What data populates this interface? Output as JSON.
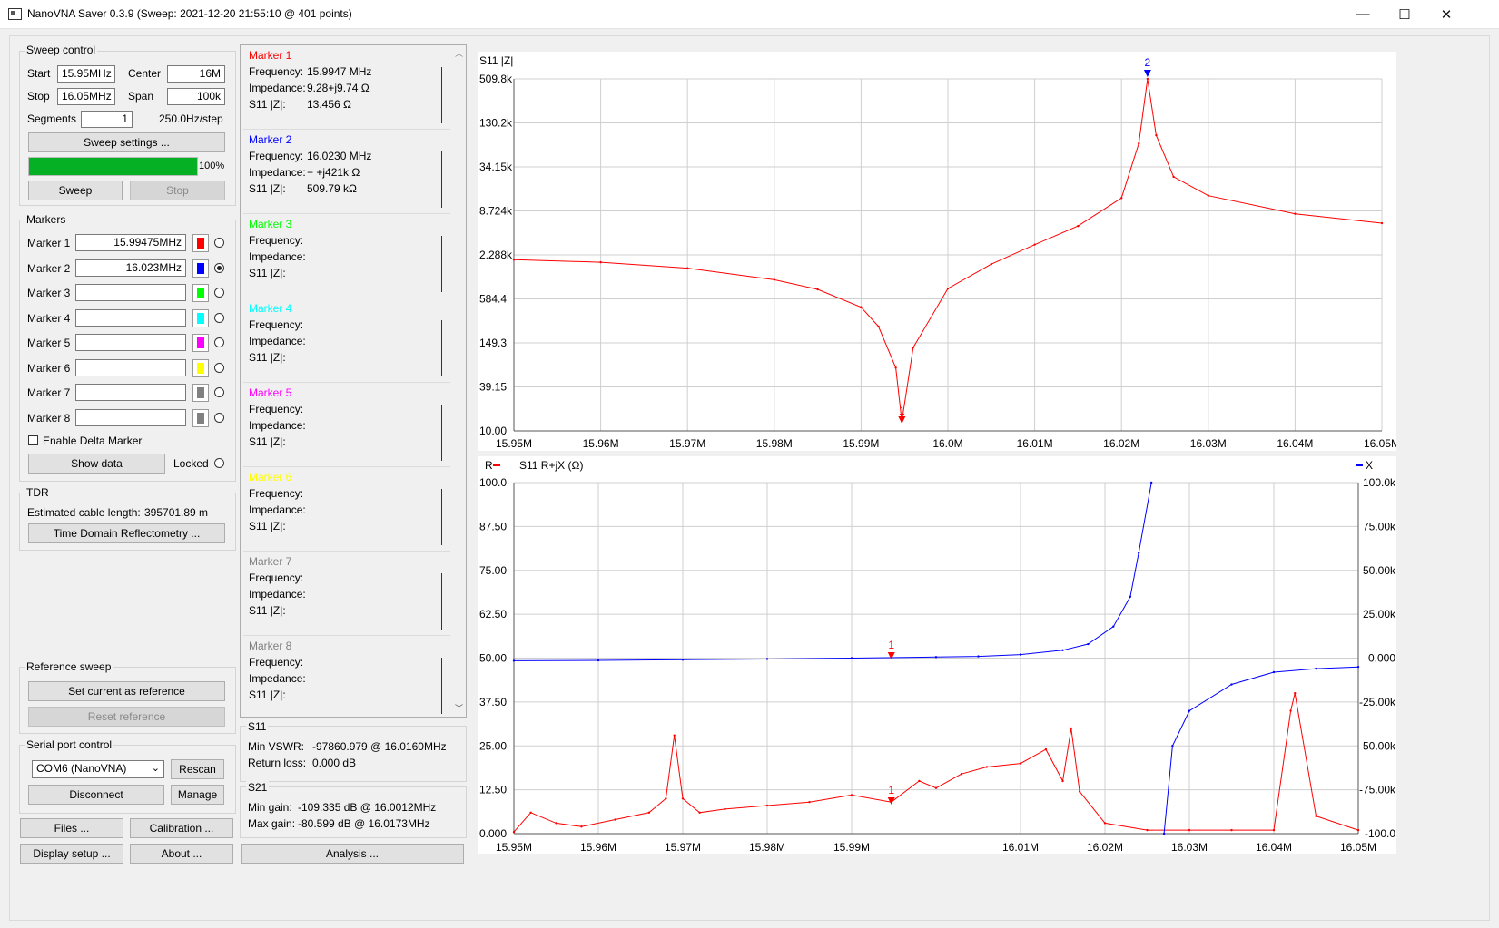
{
  "window": {
    "title": "NanoVNA Saver 0.3.9 (Sweep: 2021-12-20 21:55:10 @ 401 points)",
    "minimize_glyph": "—",
    "maximize_glyph": "☐",
    "close_glyph": "✕"
  },
  "sweep": {
    "group_title": "Sweep control",
    "start_label": "Start",
    "start_value": "15.95MHz",
    "center_label": "Center",
    "center_value": "16M",
    "stop_label": "Stop",
    "stop_value": "16.05MHz",
    "span_label": "Span",
    "span_value": "100k",
    "segments_label": "Segments",
    "segments_value": "1",
    "step_text": "250.0Hz/step",
    "settings_button": "Sweep settings ...",
    "progress_fraction": 1.0,
    "progress_text": "100%",
    "sweep_button": "Sweep",
    "stop_button": "Stop"
  },
  "markers": {
    "group_title": "Markers",
    "items": [
      {
        "label": "Marker 1",
        "value": "15.99475MHz",
        "color": "#ff0000",
        "selected": false
      },
      {
        "label": "Marker 2",
        "value": "16.023MHz",
        "color": "#0000ff",
        "selected": true
      },
      {
        "label": "Marker 3",
        "value": "",
        "color": "#00ff00",
        "selected": false
      },
      {
        "label": "Marker 4",
        "value": "",
        "color": "#00ffff",
        "selected": false
      },
      {
        "label": "Marker 5",
        "value": "",
        "color": "#ff00ff",
        "selected": false
      },
      {
        "label": "Marker 6",
        "value": "",
        "color": "#ffff00",
        "selected": false
      },
      {
        "label": "Marker 7",
        "value": "",
        "color": "#808080",
        "selected": false
      },
      {
        "label": "Marker 8",
        "value": "",
        "color": "#808080",
        "selected": false
      }
    ],
    "delta_label": "Enable Delta Marker",
    "show_data_button": "Show data",
    "locked_label": "Locked"
  },
  "tdr": {
    "group_title": "TDR",
    "cable_label": "Estimated cable length:",
    "cable_value": "395701.89 m",
    "tdr_button": "Time Domain Reflectometry ..."
  },
  "reference": {
    "group_title": "Reference sweep",
    "set_button": "Set current as reference",
    "reset_button": "Reset reference"
  },
  "serial": {
    "group_title": "Serial port control",
    "port_value": "COM6 (NanoVNA)",
    "rescan_button": "Rescan",
    "disconnect_button": "Disconnect",
    "manage_button": "Manage"
  },
  "bottom_buttons": {
    "files": "Files ...",
    "calibration": "Calibration ...",
    "display_setup": "Display setup ...",
    "about": "About ...",
    "analysis": "Analysis ..."
  },
  "marker_details": [
    {
      "title": "Marker 1",
      "color": "#ff0000",
      "freq_label": "Frequency:",
      "freq": "15.9947 MHz",
      "imp_label": "Impedance:",
      "imp": "9.28+j9.74 Ω",
      "s11_label": "S11 |Z|:",
      "s11": "13.456 Ω"
    },
    {
      "title": "Marker 2",
      "color": "#0000ff",
      "freq_label": "Frequency:",
      "freq": "16.0230 MHz",
      "imp_label": "Impedance:",
      "imp": "− +j421k Ω",
      "s11_label": "S11 |Z|:",
      "s11": "509.79 kΩ"
    },
    {
      "title": "Marker 3",
      "color": "#00ff00",
      "freq_label": "Frequency:",
      "freq": "",
      "imp_label": "Impedance:",
      "imp": "",
      "s11_label": "S11 |Z|:",
      "s11": ""
    },
    {
      "title": "Marker 4",
      "color": "#00ffff",
      "freq_label": "Frequency:",
      "freq": "",
      "imp_label": "Impedance:",
      "imp": "",
      "s11_label": "S11 |Z|:",
      "s11": ""
    },
    {
      "title": "Marker 5",
      "color": "#ff00ff",
      "freq_label": "Frequency:",
      "freq": "",
      "imp_label": "Impedance:",
      "imp": "",
      "s11_label": "S11 |Z|:",
      "s11": ""
    },
    {
      "title": "Marker 6",
      "color": "#ffff00",
      "freq_label": "Frequency:",
      "freq": "",
      "imp_label": "Impedance:",
      "imp": "",
      "s11_label": "S11 |Z|:",
      "s11": ""
    },
    {
      "title": "Marker 7",
      "color": "#808080",
      "freq_label": "Frequency:",
      "freq": "",
      "imp_label": "Impedance:",
      "imp": "",
      "s11_label": "S11 |Z|:",
      "s11": ""
    },
    {
      "title": "Marker 8",
      "color": "#808080",
      "freq_label": "Frequency:",
      "freq": "",
      "imp_label": "Impedance:",
      "imp": "",
      "s11_label": "S11 |Z|:",
      "s11": ""
    }
  ],
  "s11_summary": {
    "title": "S11",
    "vswr_label": "Min VSWR:",
    "vswr_value": "-97860.979 @ 16.0160MHz",
    "rl_label": "Return loss:",
    "rl_value": "0.000 dB"
  },
  "s21_summary": {
    "title": "S21",
    "min_label": "Min gain:",
    "min_value": "-109.335 dB @ 16.0012MHz",
    "max_label": "Max gain:",
    "max_value": "-80.599 dB @ 16.0173MHz"
  },
  "chart_data": [
    {
      "type": "line",
      "title": "S11 |Z|",
      "y_scale": "log",
      "x_ticks": [
        "15.95M",
        "15.96M",
        "15.97M",
        "15.98M",
        "15.99M",
        "16.0M",
        "16.01M",
        "16.02M",
        "16.03M",
        "16.04M",
        "16.05M"
      ],
      "y_ticks": [
        "509.8k",
        "130.2k",
        "34.15k",
        "8.724k",
        "2.288k",
        "584.4",
        "149.3",
        "39.15",
        "10.00"
      ],
      "xlim": [
        15.95,
        16.05
      ],
      "ylim": [
        10.0,
        509800
      ],
      "grid": true,
      "series": [
        {
          "color": "#ff0000",
          "x": [
            15.95,
            15.96,
            15.97,
            15.98,
            15.985,
            15.99,
            15.992,
            15.994,
            15.9947,
            15.996,
            16.0,
            16.005,
            16.01,
            16.015,
            16.02,
            16.022,
            16.023,
            16.024,
            16.026,
            16.03,
            16.04,
            16.05
          ],
          "y": [
            1950,
            1800,
            1500,
            1050,
            780,
            450,
            250,
            70,
            13.456,
            130,
            800,
            1700,
            3100,
            5500,
            13000,
            70000,
            509790,
            90000,
            25000,
            14000,
            8000,
            6000
          ]
        }
      ],
      "markers": [
        {
          "label": "1",
          "x": 15.9947,
          "color": "#ff0000",
          "position": "bottom"
        },
        {
          "label": "2",
          "x": 16.023,
          "color": "#0000ff",
          "position": "top"
        }
      ]
    },
    {
      "type": "line",
      "title": "S11 R+jX (Ω)",
      "left_legend": "R",
      "right_legend": "X",
      "x_ticks": [
        "15.95M",
        "15.96M",
        "15.97M",
        "15.98M",
        "15.99M",
        "16.01M",
        "16.02M",
        "16.03M",
        "16.04M",
        "16.05M"
      ],
      "x_tick_values": [
        15.95,
        15.96,
        15.97,
        15.98,
        15.99,
        16.01,
        16.02,
        16.03,
        16.04,
        16.05
      ],
      "y_left_ticks": [
        "100.0",
        "87.50",
        "75.00",
        "62.50",
        "50.00",
        "37.50",
        "25.00",
        "12.50",
        "0.000"
      ],
      "y_right_ticks": [
        "100.0k",
        "75.00k",
        "50.00k",
        "25.00k",
        "0.000",
        "-25.00k",
        "-50.00k",
        "-75.00k",
        "-100.0"
      ],
      "xlim": [
        15.95,
        16.05
      ],
      "ylim_left": [
        0,
        100
      ],
      "ylim_right": [
        -100000,
        100000
      ],
      "grid": true,
      "series": [
        {
          "name": "R",
          "axis": "left",
          "color": "#ff0000",
          "x": [
            15.95,
            15.952,
            15.955,
            15.958,
            15.962,
            15.966,
            15.968,
            15.969,
            15.97,
            15.972,
            15.975,
            15.98,
            15.985,
            15.99,
            15.9947,
            15.998,
            16.0,
            16.003,
            16.006,
            16.01,
            16.013,
            16.015,
            16.016,
            16.017,
            16.02,
            16.025,
            16.03,
            16.035,
            16.04,
            16.042,
            16.0425,
            16.045,
            16.05
          ],
          "y": [
            0.5,
            6,
            3,
            2,
            4,
            6,
            10,
            28,
            10,
            6,
            7,
            8,
            9,
            11,
            9,
            15,
            13,
            17,
            19,
            20,
            24,
            15,
            30,
            12,
            3,
            1,
            1,
            1,
            1,
            35,
            40,
            5,
            1
          ]
        },
        {
          "name": "X",
          "axis": "right",
          "color": "#0000ff",
          "x": [
            15.95,
            15.96,
            15.97,
            15.98,
            15.99,
            16.0,
            16.005,
            16.01,
            16.015,
            16.018,
            16.021,
            16.023,
            16.024,
            16.0255,
            16.027,
            16.028,
            16.03,
            16.035,
            16.04,
            16.045,
            16.05
          ],
          "y": [
            -1500,
            -1300,
            -900,
            -500,
            0,
            600,
            1000,
            2000,
            4500,
            8000,
            18000,
            35000,
            60000,
            100000,
            -100000,
            -50000,
            -30000,
            -15000,
            -8000,
            -6000,
            -5000
          ]
        }
      ],
      "markers": [
        {
          "label": "1",
          "x": 15.9947,
          "color": "#ff0000"
        }
      ]
    }
  ]
}
